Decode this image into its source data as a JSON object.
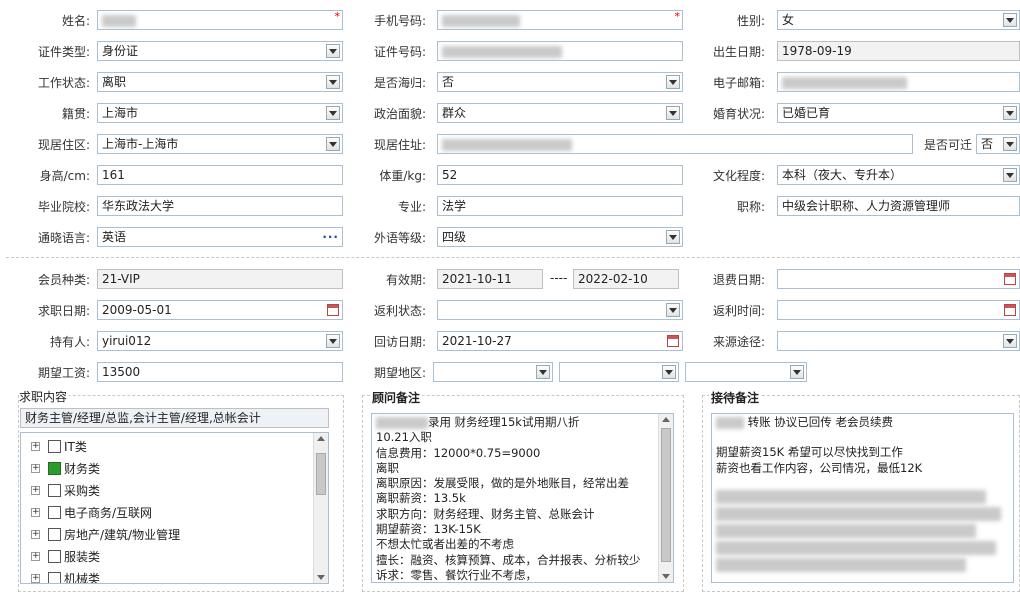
{
  "personal": {
    "name_label": "姓名:",
    "phone_label": "手机号码:",
    "gender_label": "性别:",
    "gender_value": "女",
    "id_type_label": "证件类型:",
    "id_type_value": "身份证",
    "id_no_label": "证件号码:",
    "birth_label": "出生日期:",
    "birth_value": "1978-09-19",
    "work_status_label": "工作状态:",
    "work_status_value": "离职",
    "overseas_label": "是否海归:",
    "overseas_value": "否",
    "email_label": "电子邮箱:",
    "native_label": "籍贯:",
    "native_value": "上海市",
    "political_label": "政治面貌:",
    "political_value": "群众",
    "marital_label": "婚育状况:",
    "marital_value": "已婚已育",
    "residence_area_label": "现居住区:",
    "residence_area_value": "上海市-上海市",
    "address_label": "现居住址:",
    "relocate_label": "是否可迁",
    "relocate_value": "否",
    "height_label": "身高/cm:",
    "height_value": "161",
    "weight_label": "体重/kg:",
    "weight_value": "52",
    "education_label": "文化程度:",
    "education_value": "本科（夜大、专升本）",
    "school_label": "毕业院校:",
    "school_value": "华东政法大学",
    "major_label": "专业:",
    "major_value": "法学",
    "title_label": "职称:",
    "title_value": "中级会计职称、人力资源管理师",
    "language_label": "通晓语言:",
    "language_value": "英语",
    "lang_level_label": "外语等级:",
    "lang_level_value": "四级"
  },
  "membership": {
    "member_type_label": "会员种类:",
    "member_type_value": "21-VIP",
    "validity_label": "有效期:",
    "validity_from": "2021-10-11",
    "validity_sep": "----",
    "validity_to": "2022-02-10",
    "refund_date_label": "退费日期:",
    "job_date_label": "求职日期:",
    "job_date_value": "2009-05-01",
    "rebate_status_label": "返利状态:",
    "rebate_time_label": "返利时间:",
    "holder_label": "持有人:",
    "holder_value": "yirui012",
    "visit_date_label": "回访日期:",
    "visit_date_value": "2021-10-27",
    "source_label": "来源途径:",
    "expected_salary_label": "期望工资:",
    "expected_salary_value": "13500",
    "expected_region_label": "期望地区:"
  },
  "job_content": {
    "title": "求职内容",
    "summary": "财务主管/经理/总监,会计主管/经理,总帐会计",
    "tree": [
      {
        "label": "IT类",
        "checked": false
      },
      {
        "label": "财务类",
        "checked": true
      },
      {
        "label": "采购类",
        "checked": false
      },
      {
        "label": "电子商务/互联网",
        "checked": false
      },
      {
        "label": "房地产/建筑/物业管理",
        "checked": false
      },
      {
        "label": "服装类",
        "checked": false
      },
      {
        "label": "机械类",
        "checked": false
      }
    ]
  },
  "advisor_notes": {
    "title": "顾问备注",
    "lines": [
      "录用  财务经理15k试用期八折",
      "10.21入职",
      "信息费用：12000*0.75=9000",
      "离职",
      "离职原因：发展受限，做的是外地账目，经常出差",
      "离职薪资：13.5k",
      "求职方向：财务经理、财务主管、总账会计",
      "期望薪资：13K-15K",
      "不想太忙或者出差的不考虑",
      "擅长：融资、核算预算、成本，合并报表、分析较少",
      "诉求：零售、餐饮行业不考虑，"
    ]
  },
  "reception_notes": {
    "title": "接待备注",
    "lines": [
      "转账 协议已回传 老会员续费",
      "",
      "期望薪资15K 希望可以尽快找到工作",
      "薪资也看工作内容，公司情况，最低12K"
    ]
  },
  "colors": {
    "field_border": "#a9bfd6",
    "readonly_bg": "#f2f2f2",
    "required": "#dd0000",
    "checked": "#2e9b2e"
  }
}
